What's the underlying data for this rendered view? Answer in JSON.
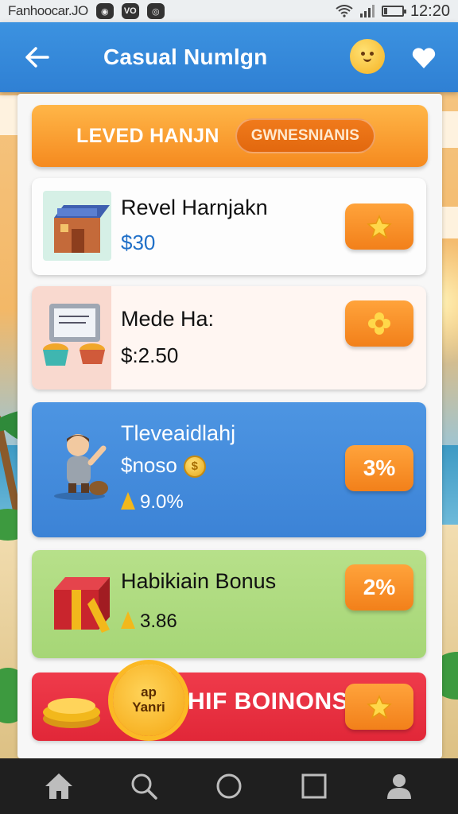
{
  "status_bar": {
    "app_name": "Fanhoocar.JO",
    "chip_1": "◉",
    "chip_2": "VO",
    "chip_3": "◎",
    "time": "12:20"
  },
  "app_bar": {
    "title": "Casual Numlgn"
  },
  "header": {
    "title": "LEVED HANJN",
    "pill_label": "GWNESNIANIS"
  },
  "cards": [
    {
      "title": "Revel Harnjakn",
      "value": "$30",
      "action_icon": "star-icon"
    },
    {
      "title": "Mede Ha:",
      "value": "$:2.50",
      "action_icon": "flower-icon"
    },
    {
      "title": "Tleveaidlahj",
      "value": "$noso",
      "sub": "9.0%",
      "action_label": "3%"
    },
    {
      "title": "Habikiain Bonus",
      "sub": "3.86",
      "action_label": "2%"
    },
    {
      "title": "HIF BOINONS",
      "seal_line_1": "ap",
      "seal_line_2": "Yanri",
      "action_icon": "star-icon"
    }
  ],
  "nav": [
    "home-icon",
    "search-icon",
    "circle-icon",
    "square-icon",
    "profile-icon"
  ],
  "colors": {
    "primary": "#2f80d4",
    "accent": "#f58a1f",
    "blue_card": "#4d95e2",
    "green_card": "#a6d676",
    "red_card": "#e12738",
    "nav_bar": "#1f1f1f"
  }
}
